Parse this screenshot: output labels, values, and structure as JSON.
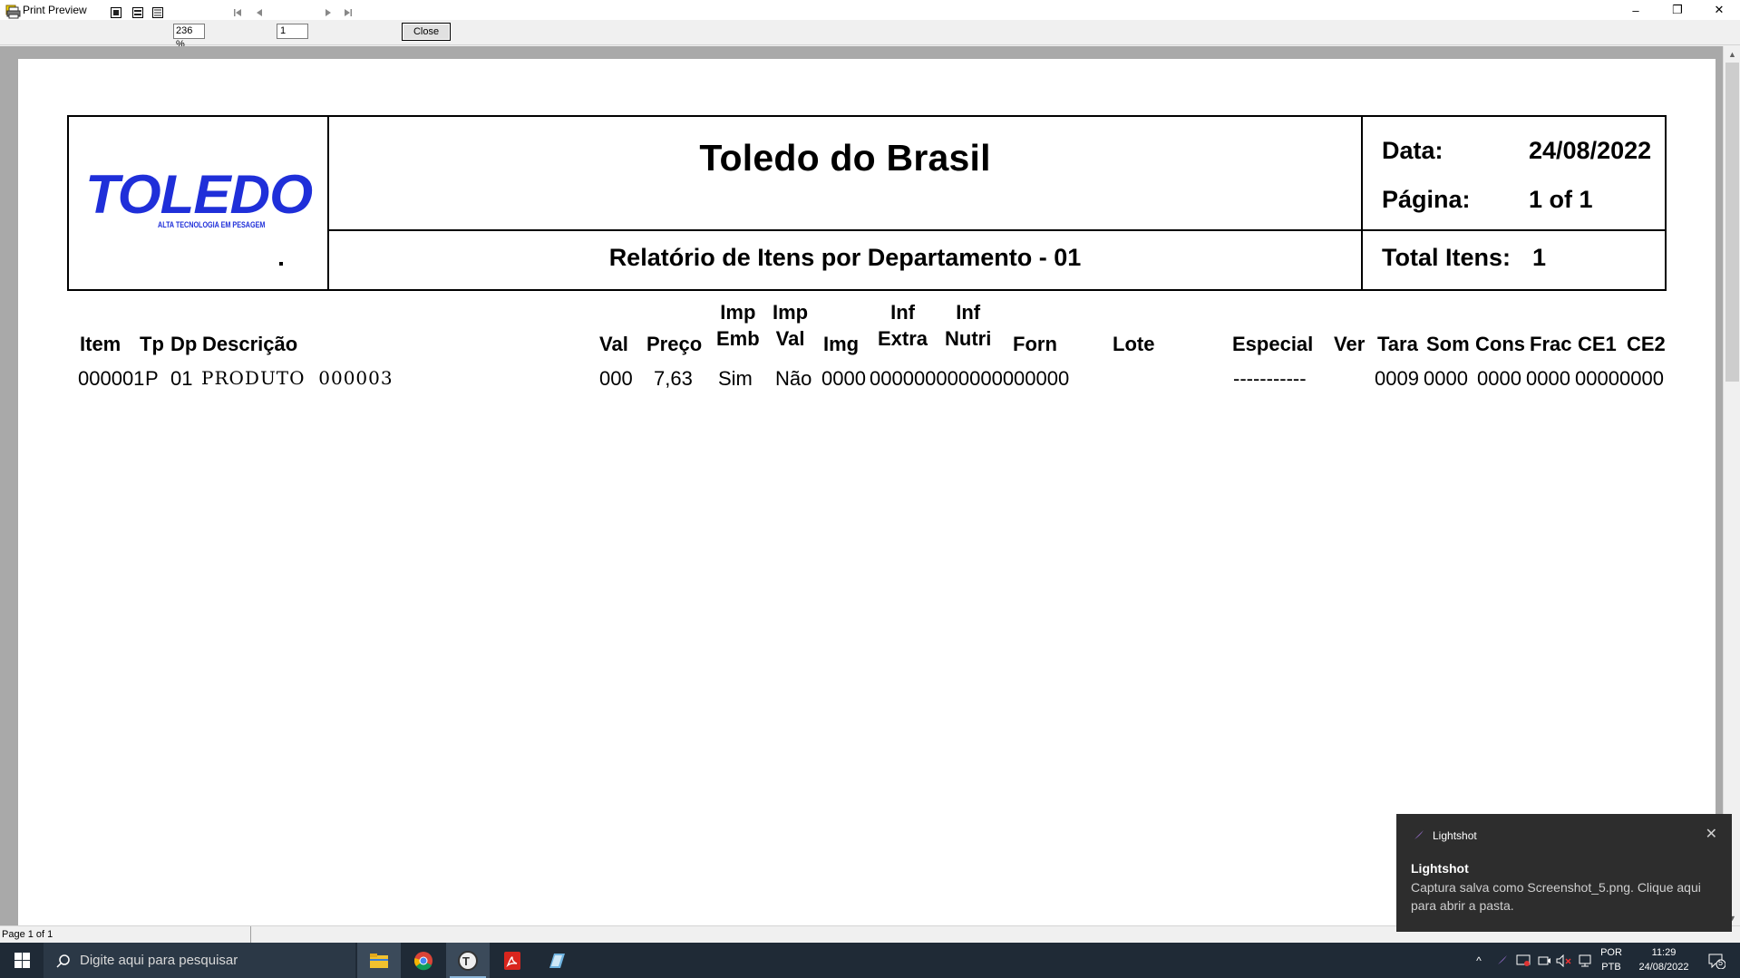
{
  "window": {
    "title": "Print Preview",
    "minimize": "–",
    "restore": "❐",
    "close": "✕"
  },
  "toolbar": {
    "zoom": "236 %",
    "page_input": "1",
    "close_label": "Close"
  },
  "report": {
    "company": "Toledo do Brasil",
    "title": "Relatório de Itens por Departamento - 01",
    "logo_text": "TOLEDO",
    "logo_tagline": "ALTA TECNOLOGIA EM PESAGEM",
    "date_label": "Data:",
    "date_value": "24/08/2022",
    "page_label": "Página:",
    "page_value": "1 of 1",
    "total_label": "Total Itens:",
    "total_value": "1",
    "columns": {
      "item": "Item",
      "tp": "Tp",
      "dp": "Dp",
      "descricao": "Descrição",
      "val": "Val",
      "preco": "Preço",
      "imp_emb_1": "Imp",
      "imp_emb_2": "Emb",
      "imp_val_1": "Imp",
      "imp_val_2": "Val",
      "img": "Img",
      "inf_extra_1": "Inf",
      "inf_extra_2": "Extra",
      "inf_nutri_1": "Inf",
      "inf_nutri_2": "Nutri",
      "forn": "Forn",
      "lote": "Lote",
      "especial": "Especial",
      "ver": "Ver",
      "tara": "Tara",
      "som": "Som",
      "cons": "Cons",
      "frac": "Frac",
      "ce1": "CE1",
      "ce2": "CE2"
    },
    "rows": [
      {
        "item": "000001",
        "tp": "P",
        "dp": "01",
        "descricao": "PRODUTO  000003",
        "val": "000",
        "preco": "7,63",
        "imp_emb": "Sim",
        "imp_val": "Não",
        "img": "0000",
        "extra_nutri_forn": "000000000000000000",
        "especial": "-----------",
        "tara": "0009",
        "som": "0000",
        "cons": "0000",
        "frac": "0000",
        "ce1": "0000",
        "ce2": "0000"
      }
    ]
  },
  "statusbar": {
    "page": "Page 1 of 1"
  },
  "taskbar": {
    "search_placeholder": "Digite aqui para pesquisar",
    "lang_top": "POR",
    "lang_bottom": "PTB",
    "time": "11:29",
    "date": "24/08/2022",
    "notif_count": "5"
  },
  "toast": {
    "app": "Lightshot",
    "title": "Lightshot",
    "body": "Captura salva como Screenshot_5.png. Clique aqui para abrir a pasta."
  }
}
